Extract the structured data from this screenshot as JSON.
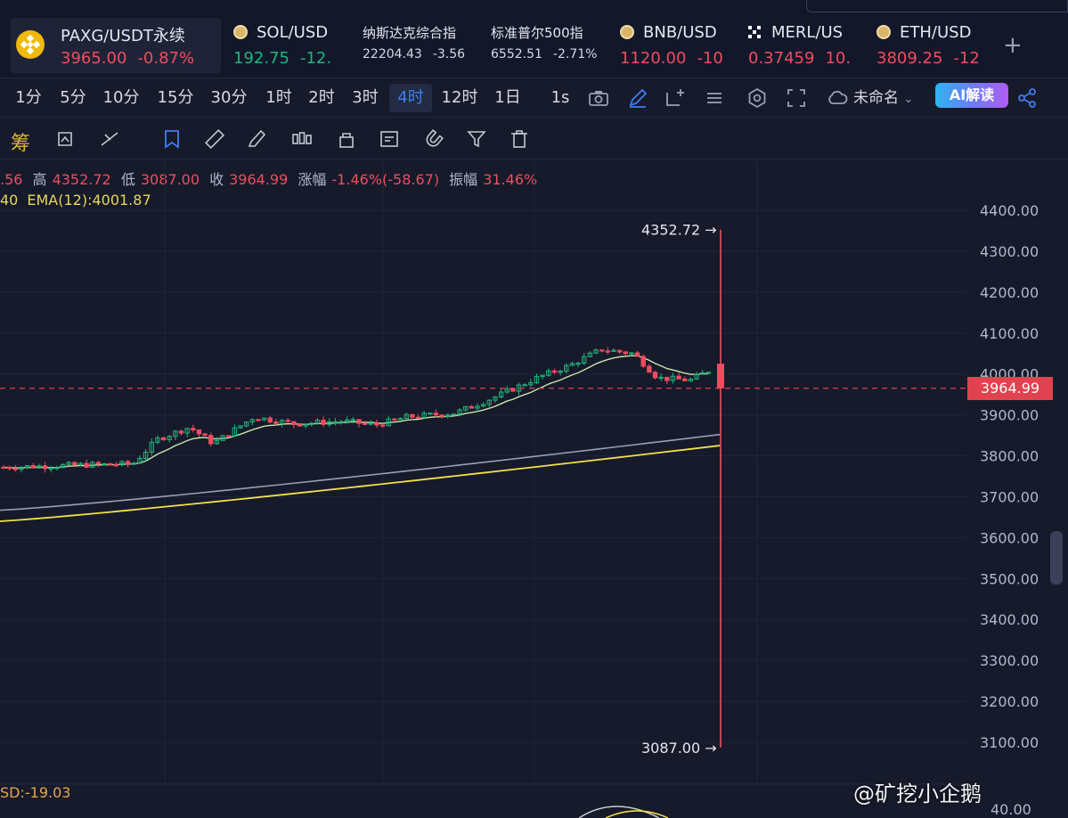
{
  "tickers": [
    {
      "name": "PAXG/USDT永续",
      "price": "3965.00",
      "change": "-0.87%",
      "dir": "down"
    },
    {
      "name": "SOL/USD",
      "price": "192.75",
      "change": "-12.",
      "dir": "up"
    },
    {
      "name": "纳斯达克综合指",
      "price": "22204.43",
      "change": "-3.56",
      "dir": "neutral"
    },
    {
      "name": "标准普尔500指",
      "price": "6552.51",
      "change": "-2.71%",
      "dir": "neutral"
    },
    {
      "name": "BNB/USD",
      "price": "1120.00",
      "change": "-10",
      "dir": "down"
    },
    {
      "name": "MERL/US",
      "price": "0.37459",
      "change": "10.",
      "dir": "down"
    },
    {
      "name": "ETH/USD",
      "price": "3809.25",
      "change": "-12",
      "dir": "down"
    }
  ],
  "toolbar": {
    "intervals": [
      "1分",
      "5分",
      "10分",
      "15分",
      "30分",
      "1时",
      "2时",
      "3时",
      "4时",
      "12时",
      "1日",
      "1s"
    ],
    "active_interval": "4时",
    "layout_name": "未命名",
    "ai_button": "AI解读",
    "chip_label": "筹"
  },
  "legend": {
    "open_partial": ".56",
    "high_label": "高",
    "high": "4352.72",
    "low_label": "低",
    "low": "3087.00",
    "close_label": "收",
    "close": "3964.99",
    "change_label": "涨幅",
    "change": "-1.46%(-58.67)",
    "amp_label": "振幅",
    "amp": "31.46%",
    "ma_partial": "40",
    "ema_label": "EMA(12):4001.87"
  },
  "chart_data": {
    "type": "candlestick",
    "y_ticks": [
      "4400.00",
      "4300.00",
      "4200.00",
      "4100.00",
      "4000.00",
      "3900.00",
      "3800.00",
      "3700.00",
      "3600.00",
      "3500.00",
      "3400.00",
      "3300.00",
      "3200.00",
      "3100.00"
    ],
    "ylim": [
      3050,
      4450
    ],
    "last_price": "3964.99",
    "high_annotation": "4352.72 →",
    "low_annotation": "3087.00 →",
    "high_value": 4352.72,
    "low_value": 3087.0,
    "last_open": 4025,
    "bottom_axis_label": "40.00",
    "indicator_label": "SD:-19.03",
    "colors": {
      "up": "#21b57c",
      "down": "#ef4d5e",
      "ema_short": "#c8e6a8",
      "ma_mid": "#9a9fb8",
      "ema_long": "#f0e04a"
    }
  },
  "watermark": "@矿挖小企鹅"
}
